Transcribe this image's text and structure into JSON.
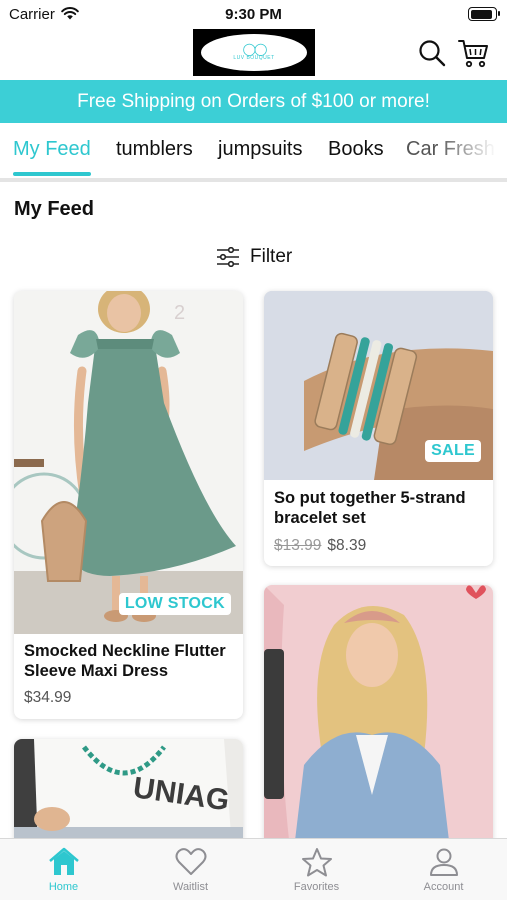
{
  "status_bar": {
    "carrier": "Carrier",
    "time": "9:30 PM",
    "battery_level": 0.9
  },
  "header": {
    "logo_text": "LUV BOUQUET",
    "brand_color": "#3ccfd6"
  },
  "banner": {
    "text": "Free Shipping on Orders of $100 or more!"
  },
  "tabs": [
    {
      "label": "My Feed",
      "active": true
    },
    {
      "label": "tumblers"
    },
    {
      "label": "jumpsuits"
    },
    {
      "label": "Books"
    },
    {
      "label": "Car Fresh"
    }
  ],
  "feed": {
    "title": "My Feed",
    "filter_label": "Filter"
  },
  "products": [
    {
      "title": "Smocked Neckline Flutter Sleeve Maxi Dress",
      "price": "$34.99",
      "badge": "LOW STOCK"
    },
    {
      "title": "So put together 5-strand bracelet set",
      "old_price": "$13.99",
      "price": "$8.39",
      "badge": "SALE"
    },
    {
      "title": "",
      "price": ""
    },
    {
      "title": "",
      "price": ""
    }
  ],
  "bottom_nav": [
    {
      "label": "Home",
      "icon": "home-icon",
      "active": true
    },
    {
      "label": "Waitlist",
      "icon": "heart-icon"
    },
    {
      "label": "Favorites",
      "icon": "star-icon"
    },
    {
      "label": "Account",
      "icon": "account-icon"
    }
  ]
}
